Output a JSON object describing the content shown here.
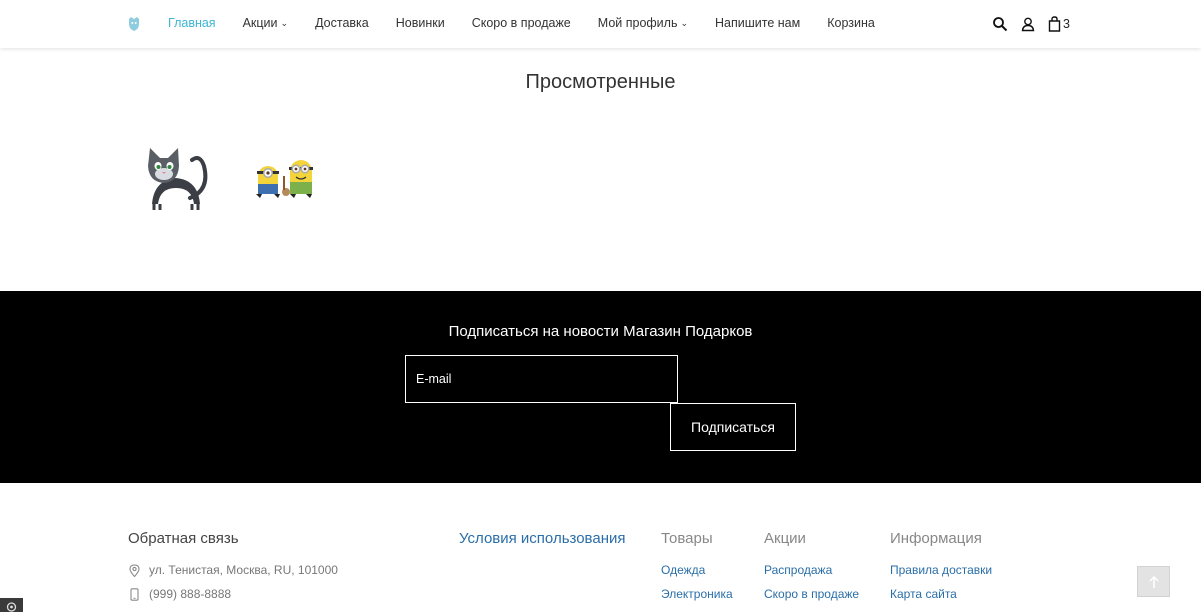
{
  "header": {
    "nav": [
      {
        "label": "Главная",
        "active": true,
        "dropdown": false
      },
      {
        "label": "Акции",
        "active": false,
        "dropdown": true
      },
      {
        "label": "Доставка",
        "active": false,
        "dropdown": false
      },
      {
        "label": "Новинки",
        "active": false,
        "dropdown": false
      },
      {
        "label": "Скоро в продаже",
        "active": false,
        "dropdown": false
      },
      {
        "label": "Мой профиль",
        "active": false,
        "dropdown": true
      },
      {
        "label": "Напишите нам",
        "active": false,
        "dropdown": false
      },
      {
        "label": "Корзина",
        "active": false,
        "dropdown": false
      }
    ],
    "icons": [
      "search-icon",
      "user-icon",
      "shopping-bag-icon"
    ],
    "cart_count": "3",
    "accent_color": "#3cb6d3"
  },
  "viewed": {
    "title": "Просмотренные",
    "items": [
      "cat-image",
      "minions-image"
    ]
  },
  "subscribe": {
    "title": "Подписаться на новости Магазин Подарков",
    "email_placeholder": "E-mail",
    "button_label": "Подписаться"
  },
  "footer": {
    "contact_title": "Обратная связь",
    "address": "ул. Тенистая, Москва, RU, 101000",
    "phone": "(999) 888-8888",
    "terms_label": "Условия использования",
    "goods": {
      "title": "Товары",
      "links": [
        "Одежда",
        "Электроника"
      ]
    },
    "promos": {
      "title": "Акции",
      "links": [
        "Распродажа",
        "Скоро в продаже"
      ]
    },
    "info": {
      "title": "Информация",
      "links": [
        "Правила доставки",
        "Карта сайта"
      ]
    },
    "link_color": "#2a6ea8"
  }
}
